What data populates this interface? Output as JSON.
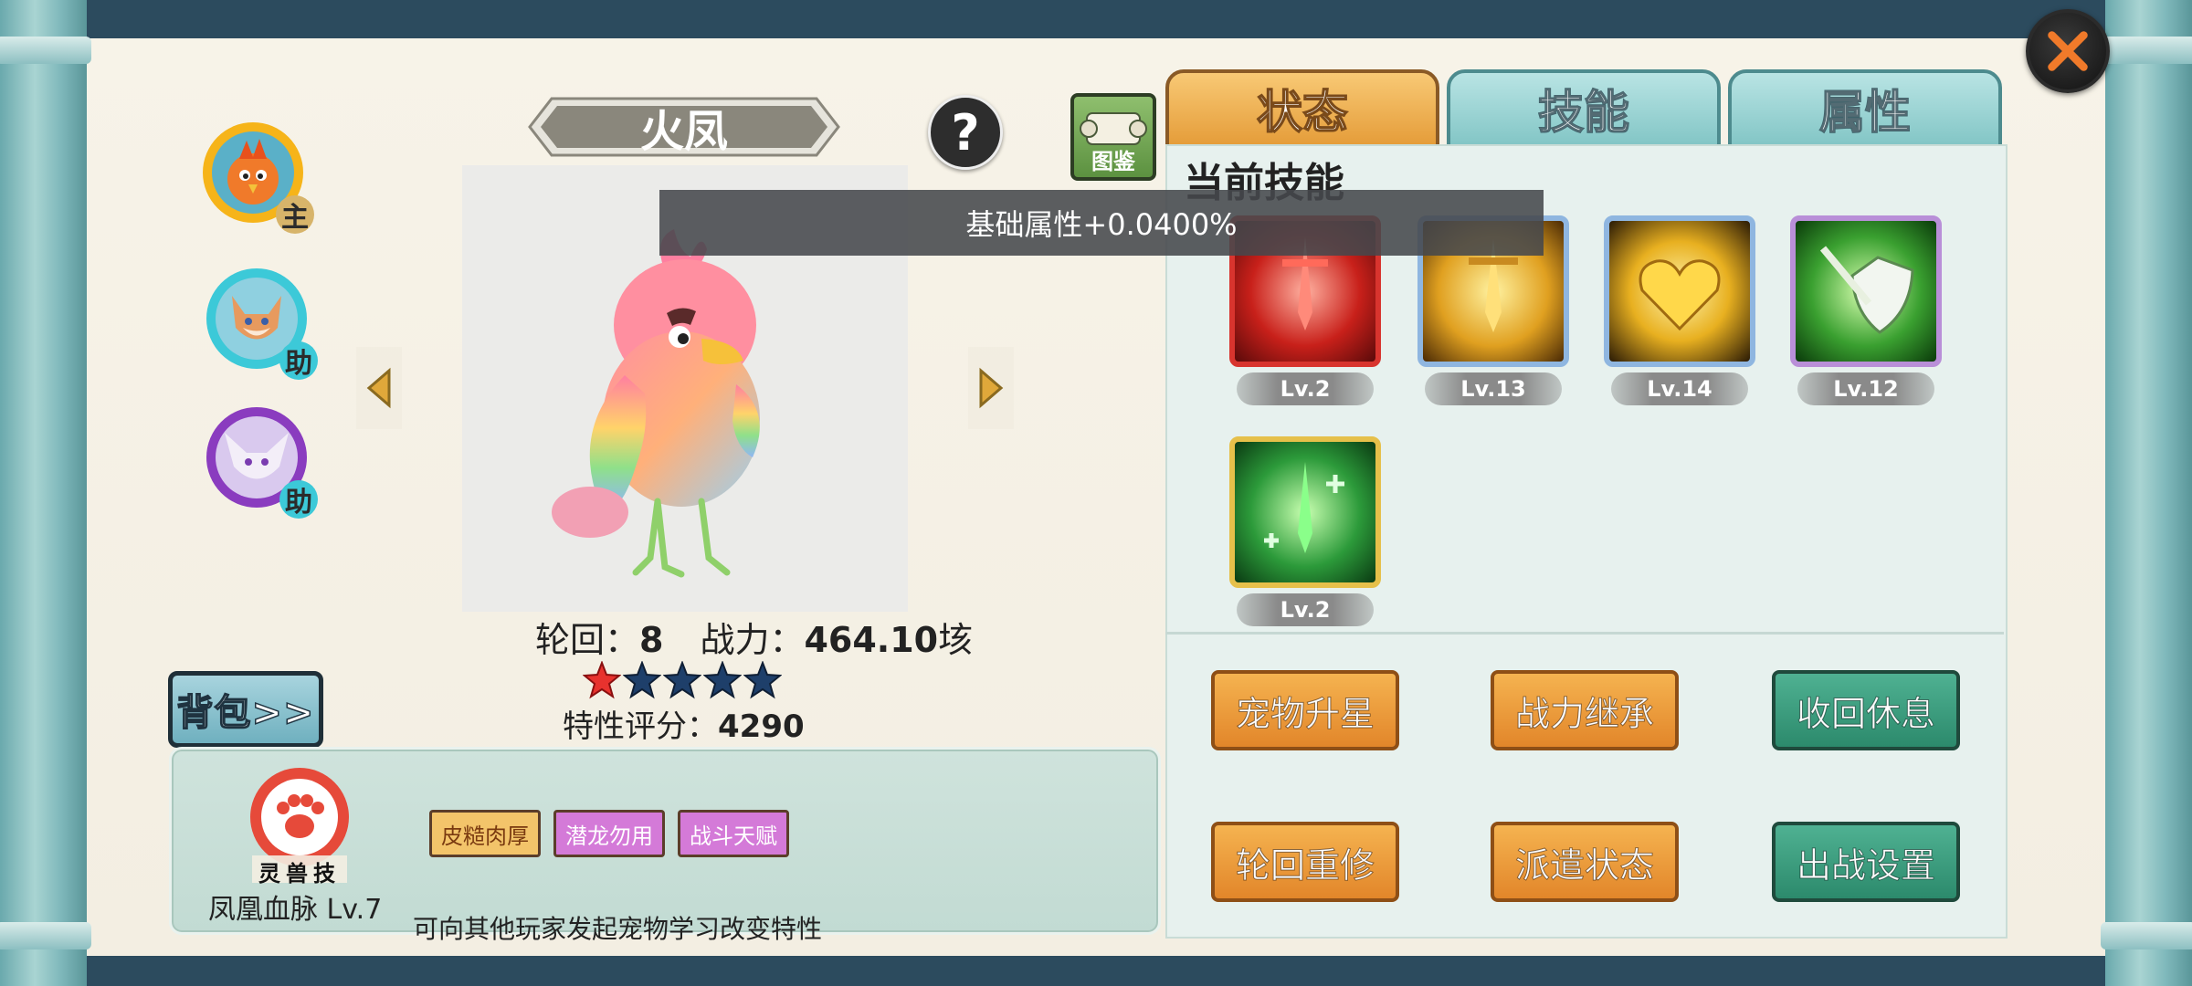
{
  "pet": {
    "name": "火凤",
    "reincarnation_label": "轮回：",
    "reincarnation_value": "8",
    "power_label": "战力：",
    "power_value": "464.10",
    "power_unit": "垓",
    "stars_total": 5,
    "stars_filled": 1,
    "trait_score_label": "特性评分：",
    "trait_score_value": "4290"
  },
  "avatars": [
    {
      "role": "主",
      "ring_color": "#f6b419"
    },
    {
      "role": "助",
      "ring_color": "#3cc9d8"
    },
    {
      "role": "助",
      "ring_color": "#8a3cbf"
    }
  ],
  "handbook_label": "图鉴",
  "help_label": "?",
  "backpack_label": "背包>>",
  "trait_panel": {
    "emblem_text": "灵兽技",
    "bloodline": "凤凰血脉 Lv.7",
    "tags": [
      "皮糙肉厚",
      "潜龙勿用",
      "战斗天赋"
    ],
    "hint": "可向其他玩家发起宠物学习改变特性"
  },
  "tabs": [
    {
      "label": "状态",
      "active": true
    },
    {
      "label": "技能",
      "active": false
    },
    {
      "label": "属性",
      "active": false
    }
  ],
  "section_title": "当前技能",
  "tooltip": "基础属性+0.0400%",
  "skills": [
    {
      "icon": "red-sword-burst-icon",
      "level": "Lv.2",
      "frame": "#d8342e"
    },
    {
      "icon": "gold-sword-rising-icon",
      "level": "Lv.13",
      "frame": "#8fb6e0"
    },
    {
      "icon": "gold-heart-crown-icon",
      "level": "Lv.14",
      "frame": "#8fb6e0"
    },
    {
      "icon": "green-shield-sword-icon",
      "level": "Lv.12",
      "frame": "#b98fd8"
    },
    {
      "icon": "green-sword-heal-icon",
      "level": "Lv.2",
      "frame": "#e6c04a"
    }
  ],
  "actions": [
    {
      "label": "宠物升星",
      "style": "orange"
    },
    {
      "label": "战力继承",
      "style": "orange"
    },
    {
      "label": "收回休息",
      "style": "green"
    },
    {
      "label": "轮回重修",
      "style": "orange"
    },
    {
      "label": "派遣状态",
      "style": "orange"
    },
    {
      "label": "出战设置",
      "style": "green"
    }
  ]
}
